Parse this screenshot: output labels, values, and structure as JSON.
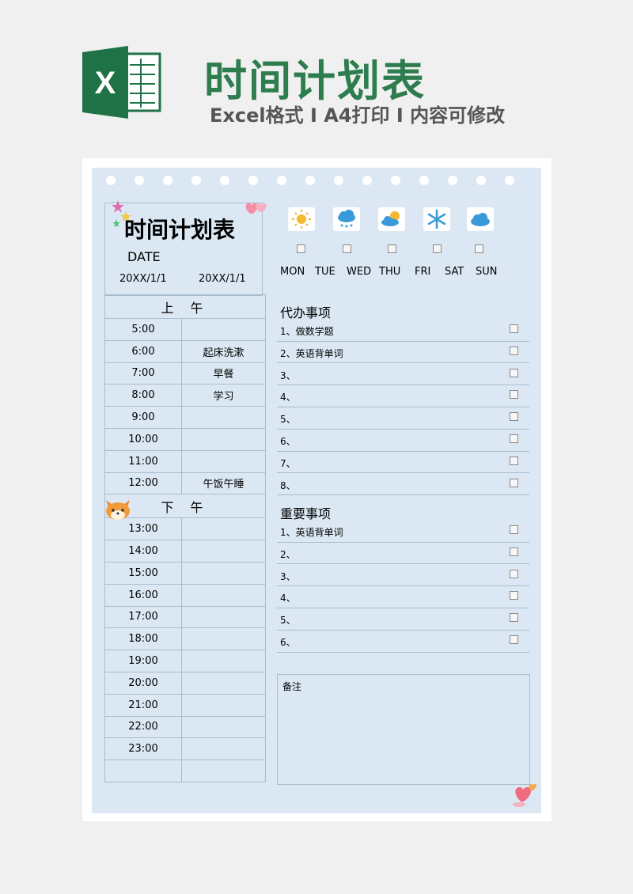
{
  "header": {
    "title": "时间计划表",
    "subtitle": "Excel格式 I A4打印 I 内容可修改",
    "logo_letter": "X"
  },
  "datebox": {
    "title": "时间计划表",
    "label": "DATE",
    "date_start": "20XX/1/1",
    "date_end": "20XX/1/1"
  },
  "schedule": {
    "morning_label": "上 午",
    "afternoon_label": "下 午",
    "morning": [
      {
        "time": "5:00",
        "task": ""
      },
      {
        "time": "6:00",
        "task": "起床洗漱"
      },
      {
        "time": "7:00",
        "task": "早餐"
      },
      {
        "time": "8:00",
        "task": "学习"
      },
      {
        "time": "9:00",
        "task": ""
      },
      {
        "time": "10:00",
        "task": ""
      },
      {
        "time": "11:00",
        "task": ""
      },
      {
        "time": "12:00",
        "task": "午饭午睡"
      }
    ],
    "afternoon": [
      {
        "time": "13:00",
        "task": ""
      },
      {
        "time": "14:00",
        "task": ""
      },
      {
        "time": "15:00",
        "task": ""
      },
      {
        "time": "16:00",
        "task": ""
      },
      {
        "time": "17:00",
        "task": ""
      },
      {
        "time": "18:00",
        "task": ""
      },
      {
        "time": "19:00",
        "task": ""
      },
      {
        "time": "20:00",
        "task": ""
      },
      {
        "time": "21:00",
        "task": ""
      },
      {
        "time": "22:00",
        "task": ""
      },
      {
        "time": "23:00",
        "task": ""
      },
      {
        "time": "",
        "task": ""
      }
    ]
  },
  "weather": [
    "sun-icon",
    "rain-cloud-icon",
    "sun-cloud-icon",
    "snowflake-icon",
    "cloud-icon"
  ],
  "days": [
    "MON",
    "TUE",
    "WED",
    "THU",
    "FRI",
    "SAT",
    "SUN"
  ],
  "todo": {
    "title": "代办事项",
    "items": [
      "1、做数学题",
      "2、英语背单词",
      "3、",
      "4、",
      "5、",
      "6、",
      "7、",
      "8、"
    ]
  },
  "important": {
    "title": "重要事项",
    "items": [
      "1、英语背单词",
      "2、",
      "3、",
      "4、",
      "5、",
      "6、"
    ]
  },
  "notes": {
    "label": "备注"
  },
  "colors": {
    "brand_green": "#2e7d4f",
    "sheet_bg": "#dbe8f4",
    "grid_line": "#a9bccd"
  }
}
